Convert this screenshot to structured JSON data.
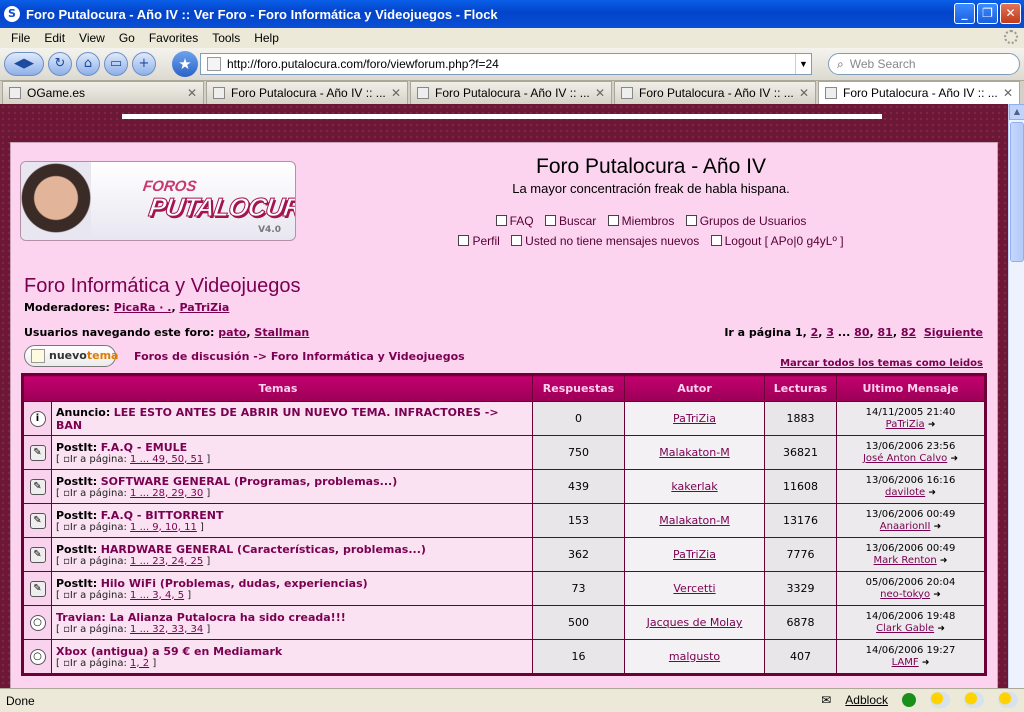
{
  "window": {
    "title": "Foro Putalocura - Año IV :: Ver Foro - Foro Informática y Videojuegos - Flock",
    "app_icon": "S"
  },
  "menu": [
    "File",
    "Edit",
    "View",
    "Go",
    "Favorites",
    "Tools",
    "Help"
  ],
  "toolbar": {
    "url": "http://foro.putalocura.com/foro/viewforum.php?f=24",
    "search_placeholder": "Web Search"
  },
  "tabs": [
    {
      "label": "OGame.es"
    },
    {
      "label": "Foro Putalocura - Año IV :: ..."
    },
    {
      "label": "Foro Putalocura - Año IV :: ..."
    },
    {
      "label": "Foro Putalocura - Año IV :: ..."
    },
    {
      "label": "Foro Putalocura - Año IV :: ..."
    }
  ],
  "site": {
    "logo_foros": "FOROS",
    "logo_puta": "PUTALOCURA",
    "logo_version": "V4.0",
    "title": "Foro Putalocura - Año IV",
    "description": "La mayor concentración freak de habla hispana.",
    "links_row1": [
      "FAQ",
      "Buscar",
      "Miembros",
      "Grupos de Usuarios"
    ],
    "links_row2": [
      "Perfil",
      "Usted no tiene mensajes nuevos",
      "Logout [ APo|0 g4yLº ]"
    ]
  },
  "forum": {
    "title": "Foro Informática y Videojuegos",
    "moderators_label": "Moderadores:",
    "moderators": [
      "PicaRa · .",
      "PaTriZia"
    ],
    "users_label": "Usuarios navegando este foro:",
    "users": [
      "pato",
      "Stallman"
    ],
    "pager_label": "Ir a página",
    "pager_pages": [
      "1",
      "2",
      "3",
      "80",
      "81",
      "82"
    ],
    "pager_next": "Siguiente",
    "newtopic_a": "nuevo",
    "newtopic_b": "tema",
    "breadcrumb": "Foros de discusión -> Foro Informática y Videojuegos",
    "mark_read": "Marcar todos los temas como leidos"
  },
  "table": {
    "headers": [
      "Temas",
      "Respuestas",
      "Autor",
      "Lecturas",
      "Ultimo Mensaje"
    ],
    "rows": [
      {
        "icon": "i",
        "prefix": "Anuncio:",
        "title": "LEE ESTO ANTES DE ABRIR UN NUEVO TEMA. INFRACTORES -> BAN",
        "pages": "",
        "replies": "0",
        "author": "PaTriZia",
        "views": "1883",
        "last_date": "14/11/2005 21:40",
        "last_user": "PaTriZia"
      },
      {
        "icon": "sticky",
        "prefix": "PostIt:",
        "title": "F.A.Q - EMULE",
        "pages": "1 ... 49, 50, 51",
        "replies": "750",
        "author": "Malakaton-M",
        "views": "36821",
        "last_date": "13/06/2006 23:56",
        "last_user": "José Anton Calvo"
      },
      {
        "icon": "sticky",
        "prefix": "PostIt:",
        "title": "SOFTWARE GENERAL (Programas, problemas...)",
        "pages": "1 ... 28, 29, 30",
        "replies": "439",
        "author": "kakerlak",
        "views": "11608",
        "last_date": "13/06/2006 16:16",
        "last_user": "davilote"
      },
      {
        "icon": "sticky",
        "prefix": "PostIt:",
        "title": "F.A.Q - BITTORRENT",
        "pages": "1 ... 9, 10, 11",
        "replies": "153",
        "author": "Malakaton-M",
        "views": "13176",
        "last_date": "13/06/2006 00:49",
        "last_user": "AnaarionII"
      },
      {
        "icon": "sticky",
        "prefix": "PostIt:",
        "title": "HARDWARE GENERAL (Características, problemas...)",
        "pages": "1 ... 23, 24, 25",
        "replies": "362",
        "author": "PaTriZia",
        "views": "7776",
        "last_date": "13/06/2006 00:49",
        "last_user": "Mark Renton"
      },
      {
        "icon": "sticky",
        "prefix": "PostIt:",
        "title": "Hilo WiFi (Problemas, dudas, experiencias)",
        "pages": "1 ... 3, 4, 5",
        "replies": "73",
        "author": "Vercetti",
        "views": "3329",
        "last_date": "05/06/2006 20:04",
        "last_user": "neo-tokyo"
      },
      {
        "icon": "topic",
        "prefix": "",
        "title": "Travian: La Alianza Putalocra ha sido creada!!!",
        "pages": "1 ... 32, 33, 34",
        "replies": "500",
        "author": "Jacques de Molay",
        "views": "6878",
        "last_date": "14/06/2006 19:48",
        "last_user": "Clark Gable"
      },
      {
        "icon": "topic",
        "prefix": "",
        "title": "Xbox (antigua) a 59 € en Mediamark",
        "pages": "1, 2",
        "replies": "16",
        "author": "malgusto",
        "views": "407",
        "last_date": "14/06/2006 19:27",
        "last_user": "LAMF"
      }
    ],
    "goto_label": "Ir a página:"
  },
  "status": {
    "text": "Done",
    "adblock": "Adblock"
  }
}
